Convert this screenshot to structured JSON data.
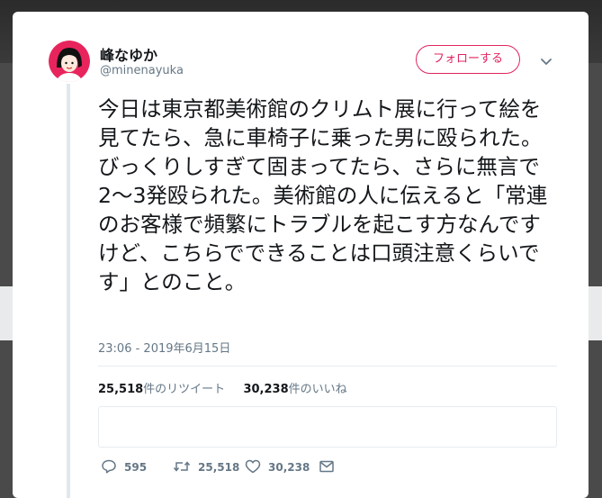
{
  "tweet": {
    "user": {
      "display_name": "峰なゆか",
      "handle": "@minenayuka"
    },
    "follow_label": "フォローする",
    "text": "今日は東京都美術館のクリムト展に行って絵を見てたら、急に車椅子に乗った男に殴られた。びっくりしすぎて固まってたら、さらに無言で2〜3発殴られた。美術館の人に伝えると「常連のお客様で頻繁にトラブルを起こす方なんですけど、こちらでできることは口頭注意くらいです」とのこと。",
    "timestamp": "23:06 - 2019年6月15日",
    "stats": {
      "retweets": "25,518",
      "retweets_label": "件のリツイート",
      "likes": "30,238",
      "likes_label": "件のいいね"
    },
    "actions": {
      "replies": "595",
      "retweets": "25,518",
      "likes": "30,238"
    }
  },
  "colors": {
    "accent": "#e0245e",
    "muted": "#657786",
    "text": "#14171a"
  },
  "icons": [
    "reply-icon",
    "retweet-icon",
    "like-icon",
    "direct-message-icon",
    "chevron-down-icon"
  ]
}
